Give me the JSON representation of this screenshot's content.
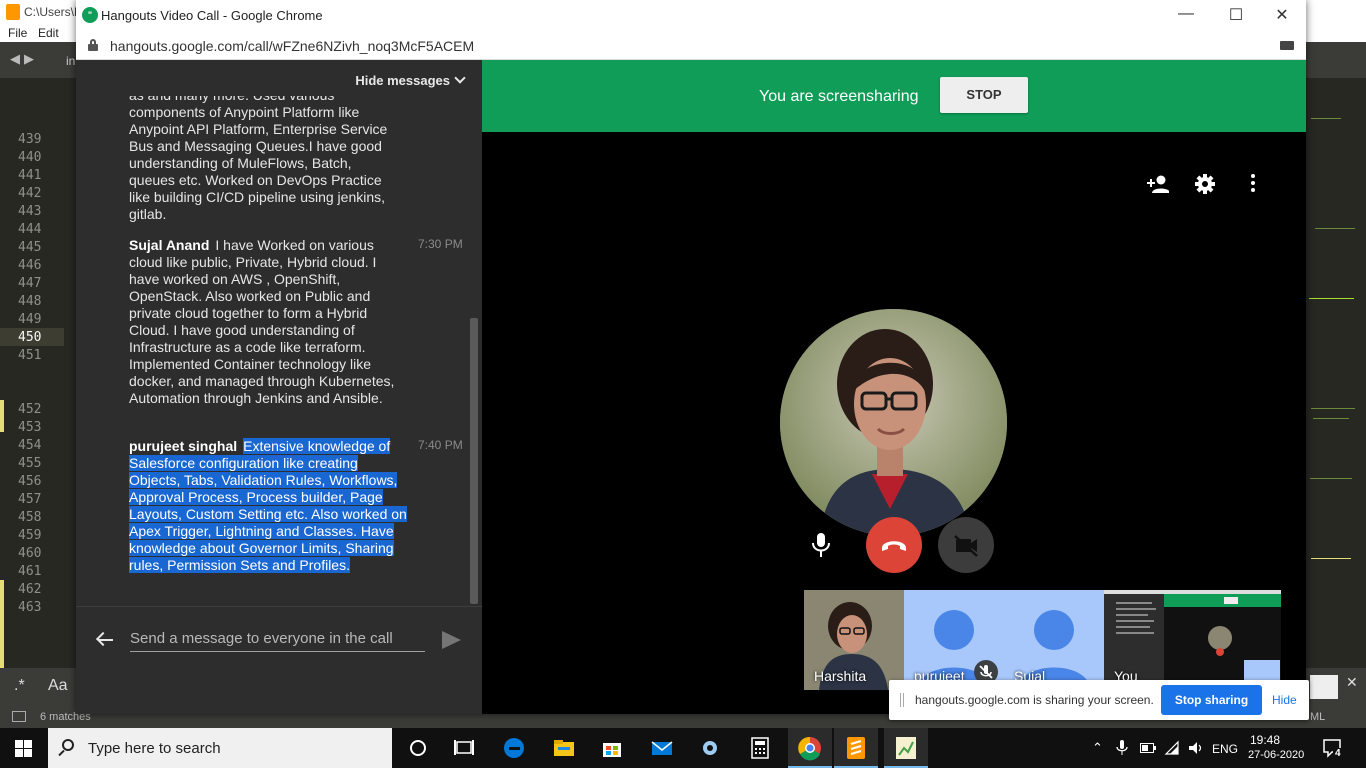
{
  "editor": {
    "title_path": "C:\\Users\\F",
    "menu": [
      "File",
      "Edit"
    ],
    "tab_label": "in",
    "line_numbers": [
      {
        "n": "439",
        "active": false
      },
      {
        "n": "440",
        "active": false
      },
      {
        "n": "441",
        "active": false
      },
      {
        "n": "442",
        "active": false
      },
      {
        "n": "443",
        "active": false
      },
      {
        "n": "444",
        "active": false
      },
      {
        "n": "445",
        "active": false
      },
      {
        "n": "446",
        "active": false
      },
      {
        "n": "447",
        "active": false
      },
      {
        "n": "448",
        "active": false
      },
      {
        "n": "449",
        "active": false
      },
      {
        "n": "450",
        "active": true
      },
      {
        "n": "451",
        "active": false
      },
      {
        "n": "452",
        "active": false
      },
      {
        "n": "453",
        "active": false
      },
      {
        "n": "454",
        "active": false
      },
      {
        "n": "455",
        "active": false
      },
      {
        "n": "456",
        "active": false
      },
      {
        "n": "457",
        "active": false
      },
      {
        "n": "458",
        "active": false
      },
      {
        "n": "459",
        "active": false
      },
      {
        "n": "460",
        "active": false
      },
      {
        "n": "461",
        "active": false
      },
      {
        "n": "462",
        "active": false
      },
      {
        "n": "463",
        "active": false
      }
    ],
    "find_regex": ".*",
    "find_case": "Aa",
    "status_matches": "6 matches",
    "status_syntax": "ML"
  },
  "chrome": {
    "window_title": "Hangouts Video Call - Google Chrome",
    "url": "hangouts.google.com/call/wFZne6NZivh_noq3McF5ACEM"
  },
  "chat": {
    "hide_label": "Hide messages",
    "messages": [
      {
        "sender": "",
        "time": "",
        "text": "as and many more. Used various components of Anypoint Platform like Anypoint API Platform, Enterprise Service Bus and Messaging Queues.I have good understanding of MuleFlows, Batch, queues etc. Worked on DevOps Practice like building CI/CD pipeline using jenkins, gitlab."
      },
      {
        "sender": "Sujal Anand",
        "time": "7:30 PM",
        "text": "I have Worked on various cloud like public, Private, Hybrid cloud. I have worked on AWS , OpenShift, OpenStack. Also worked on Public and private cloud together to form a Hybrid Cloud. I have good understanding of Infrastructure as a code like terraform. Implemented Container technology like docker, and managed through Kubernetes, Automation through Jenkins and Ansible."
      },
      {
        "sender": "purujeet singhal",
        "time": "7:40 PM",
        "text": "Extensive knowledge of Salesforce configuration like creating Objects, Tabs, Validation Rules, Workflows, Approval Process, Process builder, Page Layouts, Custom Setting etc. Also worked on Apex Trigger, Lightning and Classes. Have knowledge about Governor Limits, Sharing rules, Permission Sets and Profiles."
      }
    ],
    "input_placeholder": "Send a message to everyone in the call"
  },
  "call": {
    "banner_text": "You are screensharing",
    "stop_label": "STOP",
    "participants": [
      "Harshita",
      "purujeet",
      "Sujal",
      "You"
    ]
  },
  "share_notice": {
    "text": "hangouts.google.com is sharing your screen.",
    "stop_label": "Stop sharing",
    "hide_label": "Hide"
  },
  "taskbar": {
    "search_placeholder": "Type here to search",
    "lang": "ENG",
    "time": "19:48",
    "date": "27-06-2020",
    "notifications": "4"
  },
  "colors": {
    "hangouts_green": "#0f9d58",
    "hangup_red": "#db4437",
    "selection_blue": "#1967d2",
    "link_blue": "#1a73e8"
  }
}
